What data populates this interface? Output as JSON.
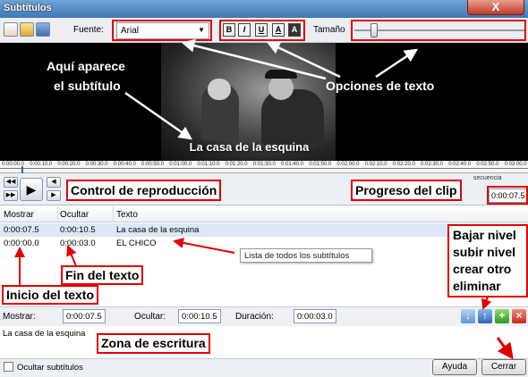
{
  "window": {
    "title": "Subtítulos",
    "close_symbol": "X"
  },
  "toolbar": {
    "font_label": "Fuente:",
    "font_value": "Arial",
    "format_buttons": [
      "B",
      "I",
      "U",
      "A",
      "A"
    ],
    "size_label": "Tamaño",
    "size_level": 0.1
  },
  "video": {
    "subtitle_text": "La casa de la esquina"
  },
  "timeline": {
    "ticks": [
      "0:00:00.0",
      "0:00:10.0",
      "0:00:20.0",
      "0:00:30.0",
      "0:00:40.0",
      "0:00:50.0",
      "0:01:00.0",
      "0:01:10.0",
      "0:01:20.0",
      "0:01:30.0",
      "0:01:40.0",
      "0:01:50.0",
      "0:02:00.0",
      "0:02:10.0",
      "0:02:20.0",
      "0:02:30.0",
      "0:02:40.0",
      "0:02:50.0",
      "0:03:00.0"
    ]
  },
  "playback": {
    "sequence_label": "secuencia",
    "current_time": "0:00:07.5"
  },
  "table": {
    "headers": [
      "Mostrar",
      "Ocultar",
      "Texto"
    ],
    "rows": [
      {
        "show": "0:00:07.5",
        "hide": "0:00:10.5",
        "text": "La casa de la esquina"
      },
      {
        "show": "0:00:00.0",
        "hide": "0:00:03.0",
        "text": "EL CHICO"
      }
    ],
    "tooltip": "Lista de todos los subtítulos"
  },
  "editor": {
    "show_label": "Mostrar:",
    "show_value": "0:00:07.5",
    "hide_label": "Ocultar:",
    "hide_value": "0:00:10.5",
    "duration_label": "Duración:",
    "duration_value": "0:00:03.0",
    "text": "La casa de la esquina"
  },
  "footer": {
    "hide_subtitles_label": "Ocultar subtítulos",
    "help_label": "Ayuda",
    "close_label": "Cerrar"
  },
  "annotations": {
    "subtitle_appears": [
      "Aquí aparece",
      "el subtítulo"
    ],
    "text_options": "Opciones de texto",
    "playback_control": "Control de reproducción",
    "clip_progress": "Progreso del clip",
    "level_buttons": [
      "Bajar nivel",
      "subir nivel",
      "crear otro",
      "eliminar"
    ],
    "text_end": "Fin del texto",
    "text_start": "Inicio del texto",
    "writing_zone": "Zona de escritura"
  },
  "colors": {
    "annotation_red": "#e00000",
    "selected_row": "#dce8f6"
  }
}
